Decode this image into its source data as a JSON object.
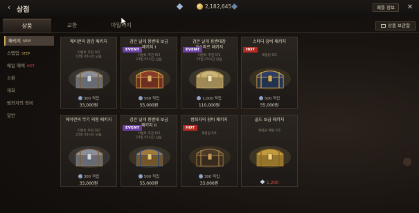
{
  "header": {
    "title": "상점",
    "back_icon": "‹",
    "currencies": [
      {
        "name": "diamond",
        "value": ""
      },
      {
        "name": "gold",
        "value": "2,182,645"
      },
      {
        "name": "gem",
        "value": ""
      }
    ],
    "info_button": "패틀 정보",
    "close_icon": "✕"
  },
  "tabs": [
    {
      "label": "상품"
    },
    {
      "label": "교환"
    },
    {
      "label": "마일리지"
    }
  ],
  "storage_button": "상품 보관함",
  "sidebar": [
    {
      "label": "패키지",
      "badge": "NEW",
      "badge_color": "#cbbba0"
    },
    {
      "label": "스텝업",
      "badge": "STEP",
      "badge_color": "#c9a55a"
    },
    {
      "label": "매일 혜택",
      "badge": "HOT",
      "badge_color": "#d4473a"
    },
    {
      "label": "소환",
      "badge": "",
      "badge_color": ""
    },
    {
      "label": "재화",
      "badge": "",
      "badge_color": ""
    },
    {
      "label": "범죄자의 장비",
      "badge": "",
      "badge_color": ""
    },
    {
      "label": "일반",
      "badge": "",
      "badge_color": ""
    }
  ],
  "cards": [
    {
      "title": "메이런의 장갑 패키지",
      "badge": "",
      "limit": "이벤트 추천 0/2\n13일 03시간 남음",
      "chest": "silver",
      "cost": "300 적립",
      "price": "33,000원",
      "price_red": false
    },
    {
      "title": "검은 날개 용병대 보급\n패키지 I",
      "badge": "EVENT",
      "limit": "이벤트 추천 0/2\n13일 03시간 남음",
      "chest": "red",
      "cost": "500 적립",
      "price": "55,000원",
      "price_red": false
    },
    {
      "title": "검은 날개 용병대장\n가스파르 패키지",
      "badge": "EVENT",
      "limit": "이벤트 추천 0/1\n13일 03시간 남음",
      "chest": "gold",
      "cost": "1,000 적립",
      "price": "110,000원",
      "price_red": false
    },
    {
      "title": "스타터 장비 패키지",
      "badge": "HOT",
      "limit": "계정당 0/1",
      "chest": "blue",
      "cost": "500 적립",
      "price": "55,000원",
      "price_red": false
    },
    {
      "title": "메이런의 무기 외형 패키지",
      "badge": "",
      "limit": "이벤트 추천 0/2\n13일 03시간 남음",
      "chest": "silver",
      "cost": "300 적립",
      "price": "33,000원",
      "price_red": false
    },
    {
      "title": "검은 날개 용병대 보급\n패키지 II",
      "badge": "EVENT",
      "limit": "이벤트 추천 0/2\n13일 03시간 남음",
      "chest": "blue2",
      "cost": "500 적립",
      "price": "55,000원",
      "price_red": false
    },
    {
      "title": "범죄자의 장비 패키지",
      "badge": "HOT",
      "limit": "계정당 0/1",
      "chest": "dark",
      "cost": "300 적립",
      "price": "33,000원",
      "price_red": false
    },
    {
      "title": "골드 보급 패키지",
      "badge": "",
      "limit": "계정당 매일 0/1",
      "chest": "goldbig",
      "cost": "",
      "price": "1,200",
      "price_red": true
    }
  ]
}
